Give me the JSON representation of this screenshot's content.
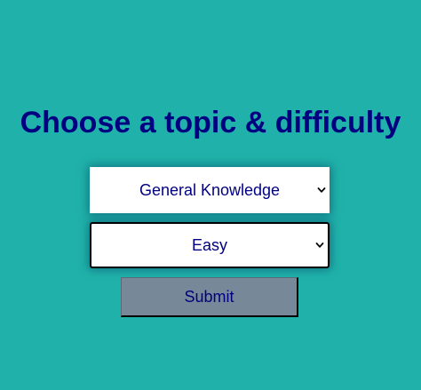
{
  "page": {
    "title": "Choose a topic & difficulty"
  },
  "topic": {
    "selected": "General Knowledge"
  },
  "difficulty": {
    "selected": "Easy"
  },
  "submit": {
    "label": "Submit"
  },
  "colors": {
    "background": "#20b2aa",
    "title": "#000080",
    "select_background": "#ffffff",
    "button_background": "#778899"
  },
  "icons": {
    "dropdown": "chevron-down-icon"
  }
}
